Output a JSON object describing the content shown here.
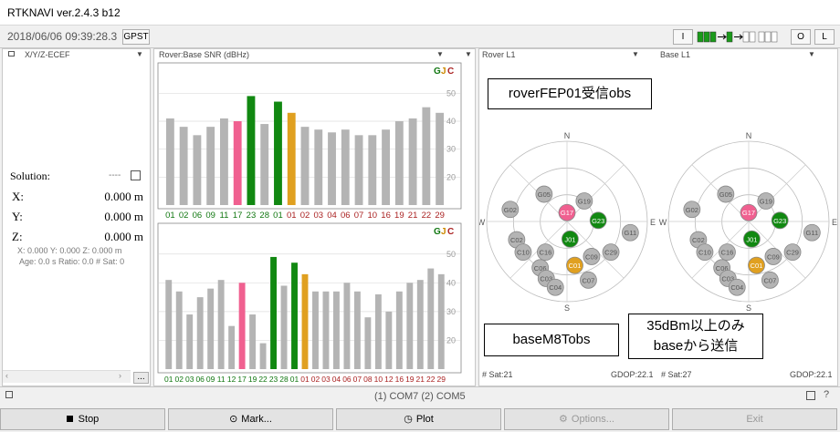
{
  "window": {
    "title": "RTKNAVI ver.2.4.3 b12"
  },
  "toolbar": {
    "datetime": "2018/06/06 09:39:28.3",
    "timesys_label": "GPST",
    "btn_i": "I",
    "btn_o": "O",
    "btn_l": "L"
  },
  "left_panel": {
    "mode": "X/Y/Z-ECEF",
    "solution_label": "Solution:",
    "solution_value": "----",
    "x_label": "X:",
    "x_value": "0.000 m",
    "y_label": "Y:",
    "y_value": "0.000 m",
    "z_label": "Z:",
    "z_value": "0.000 m",
    "detail1": "X: 0.000 Y: 0.000 Z: 0.000 m",
    "detail2": "Age: 0.0 s Ratio: 0.0 # Sat: 0",
    "more_button": "..."
  },
  "mid_panel": {
    "title": "Rover:Base SNR (dBHz)",
    "legend_g": "G",
    "legend_j": "J",
    "legend_c": "C",
    "colors": {
      "gray": "#b4b4b4",
      "green": "#118811",
      "pink": "#f06090",
      "orange": "#e0a020",
      "prn_green": "#117711",
      "prn_red": "#aa2222"
    },
    "y_ticks": [
      "50",
      "40",
      "30",
      "20"
    ]
  },
  "chart_data": [
    {
      "type": "bar",
      "title": "Rover",
      "categories": [
        "01",
        "02",
        "06",
        "09",
        "11",
        "17",
        "23",
        "28",
        "01",
        "01",
        "02",
        "03",
        "04",
        "06",
        "07",
        "10",
        "16",
        "19",
        "21",
        "22",
        "29"
      ],
      "values": [
        41,
        38,
        35,
        38,
        41,
        40,
        49,
        39,
        47,
        43,
        38,
        37,
        36,
        37,
        35,
        35,
        37,
        40,
        41,
        45,
        43
      ],
      "colors": [
        "gray",
        "gray",
        "gray",
        "gray",
        "gray",
        "pink",
        "green",
        "gray",
        "green",
        "orange",
        "gray",
        "gray",
        "gray",
        "gray",
        "gray",
        "gray",
        "gray",
        "gray",
        "gray",
        "gray",
        "gray"
      ],
      "label_colors": [
        "green",
        "green",
        "green",
        "green",
        "green",
        "green",
        "green",
        "green",
        "green",
        "red",
        "red",
        "red",
        "red",
        "red",
        "red",
        "red",
        "red",
        "red",
        "red",
        "red",
        "red"
      ],
      "ylim": [
        10,
        55
      ]
    },
    {
      "type": "bar",
      "title": "Base",
      "categories": [
        "01",
        "02",
        "03",
        "06",
        "09",
        "11",
        "12",
        "17",
        "19",
        "22",
        "23",
        "28",
        "01",
        "01",
        "02",
        "03",
        "04",
        "06",
        "07",
        "08",
        "10",
        "12",
        "16",
        "19",
        "21",
        "22",
        "29"
      ],
      "values": [
        41,
        37,
        29,
        35,
        38,
        41,
        25,
        40,
        29,
        19,
        49,
        39,
        47,
        43,
        37,
        37,
        37,
        40,
        37,
        28,
        36,
        30,
        37,
        40,
        41,
        45,
        43
      ],
      "colors": [
        "gray",
        "gray",
        "gray",
        "gray",
        "gray",
        "gray",
        "gray",
        "pink",
        "gray",
        "gray",
        "green",
        "gray",
        "green",
        "orange",
        "gray",
        "gray",
        "gray",
        "gray",
        "gray",
        "gray",
        "gray",
        "gray",
        "gray",
        "gray",
        "gray",
        "gray",
        "gray"
      ],
      "label_colors": [
        "green",
        "green",
        "green",
        "green",
        "green",
        "green",
        "green",
        "green",
        "green",
        "green",
        "green",
        "green",
        "green",
        "red",
        "red",
        "red",
        "red",
        "red",
        "red",
        "red",
        "red",
        "red",
        "red",
        "red",
        "red",
        "red",
        "red"
      ],
      "ylim": [
        10,
        55
      ]
    }
  ],
  "right_panel": {
    "rover_label": "Rover L1",
    "base_label": "Base L1",
    "compass": {
      "n": "N",
      "s": "S",
      "e": "E",
      "w": "W"
    },
    "sats": [
      "G02",
      "G05",
      "G19",
      "G17",
      "G23",
      "J01",
      "C02",
      "G11",
      "C10",
      "C16",
      "C09",
      "C29",
      "C01",
      "C06",
      "C03",
      "C04",
      "C07"
    ],
    "rover_sats_count": "# Sat:21",
    "rover_gdop": "GDOP:22.1",
    "base_sats_count": "# Sat:27",
    "base_gdop": "GDOP:22.1"
  },
  "annotations": {
    "rover_note": "roverFEP01受信obs",
    "base_note": "baseM8Tobs",
    "filter_note_line1": "35dBm以上のみ",
    "filter_note_line2": "baseから送信"
  },
  "statusbar": {
    "ports": "(1) COM7 (2) COM5"
  },
  "buttons": {
    "stop": "Stop",
    "mark": "Mark...",
    "plot": "Plot",
    "options": "Options...",
    "exit": "Exit"
  }
}
